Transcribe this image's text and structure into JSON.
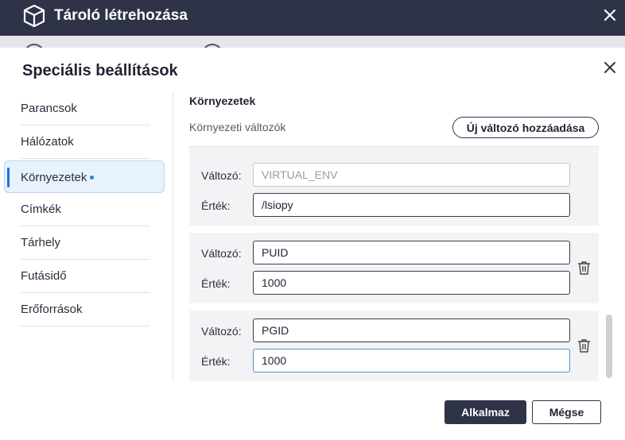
{
  "window": {
    "title": "Tároló létrehozása",
    "app_icon": "cube-icon",
    "close_icon": "close-icon"
  },
  "dialog": {
    "title": "Speciális beállítások",
    "close_icon": "close-icon",
    "nav": [
      {
        "label": "Parancsok",
        "active": false
      },
      {
        "label": "Hálózatok",
        "active": false
      },
      {
        "label": "Környezetek",
        "active": true
      },
      {
        "label": "Címkék",
        "active": false
      },
      {
        "label": "Tárhely",
        "active": false
      },
      {
        "label": "Futásidő",
        "active": false
      },
      {
        "label": "Erőforrások",
        "active": false
      }
    ],
    "section_title": "Környezetek",
    "env_label": "Környezeti változók",
    "add_button": "Új változó hozzáadása",
    "variable_label": "Változó:",
    "value_label": "Érték:",
    "variables": [
      {
        "name": "VIRTUAL_ENV",
        "value": "/lsiopy",
        "name_disabled": true,
        "deletable": false
      },
      {
        "name": "PUID",
        "value": "1000",
        "name_disabled": false,
        "deletable": true
      },
      {
        "name": "PGID",
        "value": "1000",
        "name_disabled": false,
        "deletable": true,
        "value_focused": true
      }
    ],
    "apply_button": "Alkalmaz",
    "cancel_button": "Mégse"
  },
  "colors": {
    "titlebar": "#2f3347",
    "accent": "#1a73e8",
    "active_bg": "#e8f2fc"
  }
}
